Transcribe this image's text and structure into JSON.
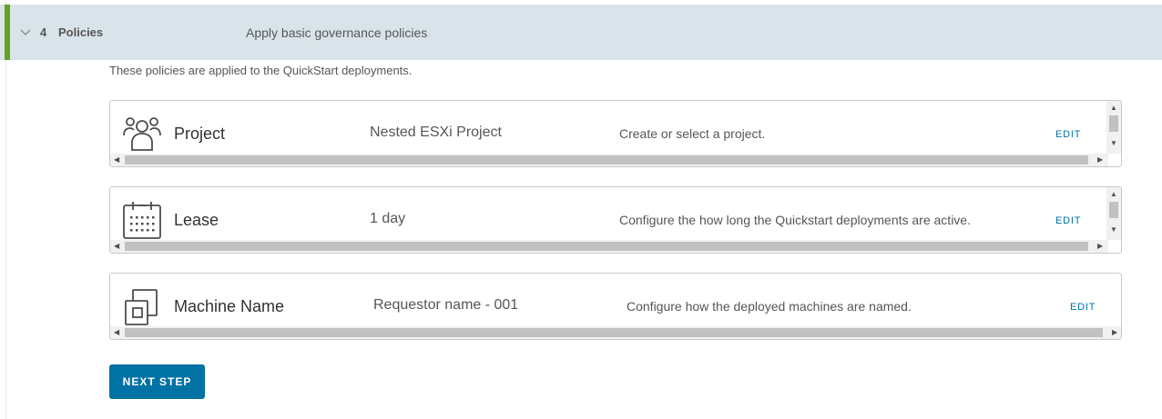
{
  "step": {
    "number": "4",
    "title": "Policies",
    "description": "Apply basic governance policies"
  },
  "intro_text": "These policies are applied to the QuickStart deployments.",
  "policies": [
    {
      "icon": "project-users-icon",
      "name": "Project",
      "value": "Nested ESXi Project",
      "description": "Create or select a project.",
      "edit_label": "EDIT"
    },
    {
      "icon": "calendar-icon",
      "name": "Lease",
      "value": "1 day",
      "description": "Configure the how long the Quickstart deployments are active.",
      "edit_label": "EDIT"
    },
    {
      "icon": "copy-machines-icon",
      "name": "Machine Name",
      "value": "Requestor name - 001",
      "description": "Configure how the deployed machines are named.",
      "edit_label": "EDIT"
    }
  ],
  "next_button": "NEXT STEP",
  "colors": {
    "accent": "#62a420",
    "primary": "#0072a3",
    "step_bar": "#d9e4ea"
  }
}
